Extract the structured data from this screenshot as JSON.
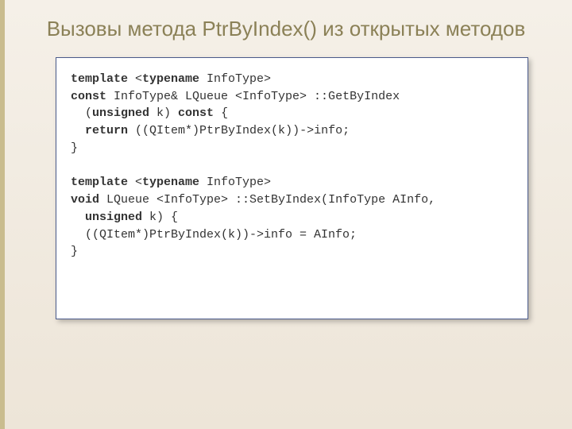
{
  "slide": {
    "title": "Вызовы метода PtrByIndex() из открытых методов"
  },
  "code": {
    "l1": {
      "kw1": "template",
      "rest": " <",
      "kw2": "typename",
      "rest2": " InfoType>"
    },
    "l2": {
      "kw1": "const",
      "rest": " InfoType& LQueue <InfoType> ::GetByIndex"
    },
    "l3": {
      "pre": "  (",
      "kw1": "unsigned",
      "mid": " k) ",
      "kw2": "const",
      "rest": " {"
    },
    "l4": {
      "pre": "  ",
      "kw1": "return",
      "rest": " ((QItem*)PtrByIndex(k))->info;"
    },
    "l5": {
      "text": "}"
    },
    "l6": {
      "text": ""
    },
    "l7": {
      "kw1": "template",
      "rest": " <",
      "kw2": "typename",
      "rest2": " InfoType>"
    },
    "l8": {
      "kw1": "void",
      "rest": " LQueue <InfoType> ::SetByIndex(InfoType AInfo,"
    },
    "l9": {
      "pre": "  ",
      "kw1": "unsigned",
      "rest": " k) {"
    },
    "l10": {
      "text": "  ((QItem*)PtrByIndex(k))->info = AInfo;"
    },
    "l11": {
      "text": "}"
    }
  }
}
